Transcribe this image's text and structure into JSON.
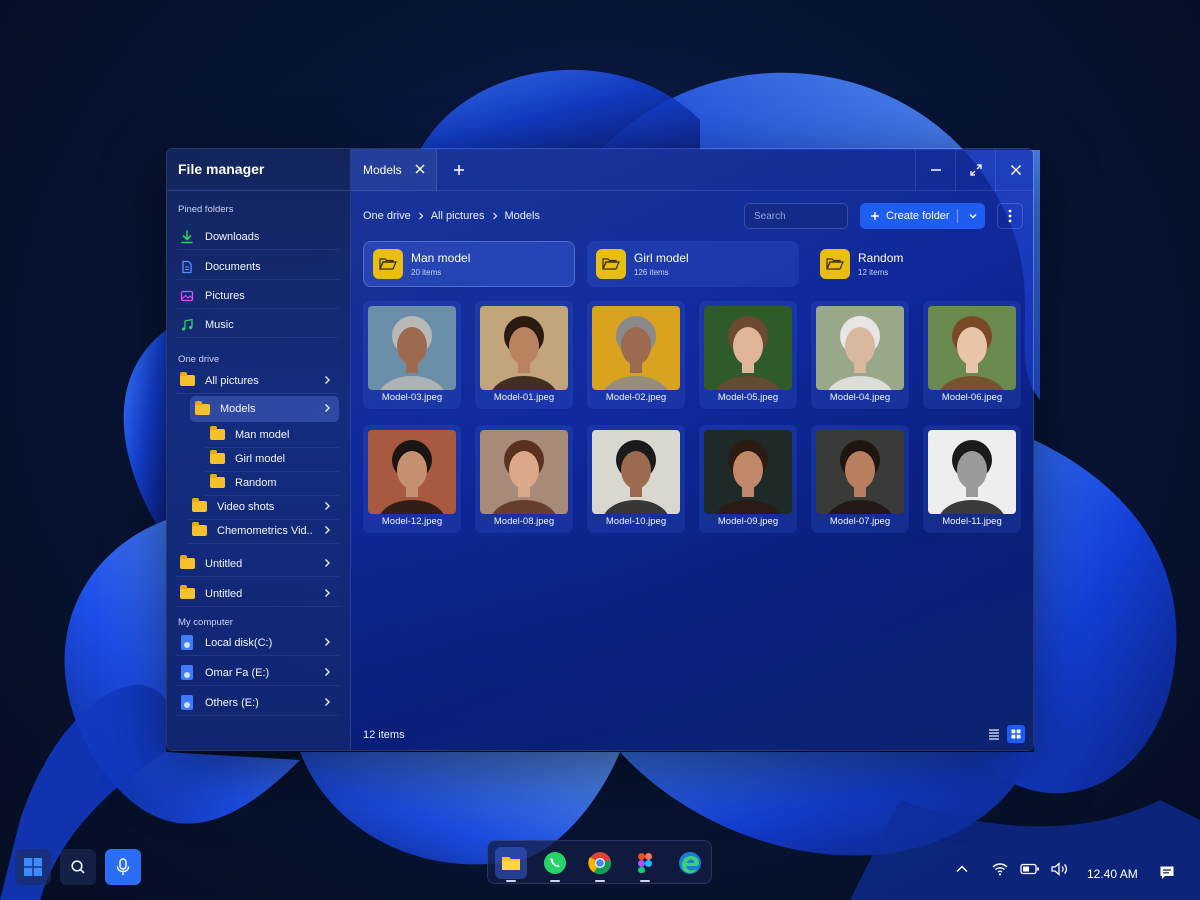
{
  "window": {
    "title": "File manager",
    "tab_label": "Models"
  },
  "sidebar": {
    "sections": {
      "pinned": "Pined folders",
      "onedrive": "One drive",
      "computer": "My computer"
    },
    "pinned": [
      {
        "label": "Downloads",
        "icon": "download-icon"
      },
      {
        "label": "Documents",
        "icon": "document-icon"
      },
      {
        "label": "Pictures",
        "icon": "image-icon"
      },
      {
        "label": "Music",
        "icon": "music-icon"
      }
    ],
    "onedrive": [
      {
        "label": "All pictures"
      },
      {
        "label": "Models"
      },
      {
        "label": "Man model"
      },
      {
        "label": "Girl model"
      },
      {
        "label": "Random"
      },
      {
        "label": "Video shots"
      },
      {
        "label": "Chemometrics Vid.."
      },
      {
        "label": "Untitled"
      },
      {
        "label": "Untitled"
      }
    ],
    "computer": [
      {
        "label": "Local disk(C:)"
      },
      {
        "label": "Omar Fa (E:)"
      },
      {
        "label": "Others (E:)"
      }
    ]
  },
  "toolbar": {
    "breadcrumb": [
      "One drive",
      "All pictures",
      "Models"
    ],
    "search_placeholder": "Search",
    "create_label": "Create folder"
  },
  "folders": [
    {
      "name": "Man model",
      "count": "20 items"
    },
    {
      "name": "Girl model",
      "count": "126 items"
    },
    {
      "name": "Random",
      "count": "12 items"
    }
  ],
  "files": [
    {
      "name": "Model-03.jpeg",
      "bg": "#6b8fa8",
      "skin": "#9c6a4f",
      "hair": "#b8b8b8"
    },
    {
      "name": "Model-01.jpeg",
      "bg": "#c2a57a",
      "skin": "#b88460",
      "hair": "#2b1a12"
    },
    {
      "name": "Model-02.jpeg",
      "bg": "#d9a320",
      "skin": "#9c6a4f",
      "hair": "#8a8a8a"
    },
    {
      "name": "Model-05.jpeg",
      "bg": "#2f5a2a",
      "skin": "#e0b59a",
      "hair": "#6b4a30"
    },
    {
      "name": "Model-04.jpeg",
      "bg": "#9aa88a",
      "skin": "#d9b8a0",
      "hair": "#e6e6e6"
    },
    {
      "name": "Model-06.jpeg",
      "bg": "#6b8a50",
      "skin": "#e8c4a8",
      "hair": "#7a4a28"
    },
    {
      "name": "Model-12.jpeg",
      "bg": "#a85a40",
      "skin": "#c49070",
      "hair": "#1c1410"
    },
    {
      "name": "Model-08.jpeg",
      "bg": "#a88a78",
      "skin": "#d8a888",
      "hair": "#5a3020"
    },
    {
      "name": "Model-10.jpeg",
      "bg": "#d8d8d0",
      "skin": "#9c6a4f",
      "hair": "#1a1a1a"
    },
    {
      "name": "Model-09.jpeg",
      "bg": "#1e2a28",
      "skin": "#c08868",
      "hair": "#2a1a10"
    },
    {
      "name": "Model-07.jpeg",
      "bg": "#3a3a38",
      "skin": "#b88060",
      "hair": "#1e1410"
    },
    {
      "name": "Model-11.jpeg",
      "bg": "#eeeeee",
      "skin": "#9a9a9a",
      "hair": "#1a1a1a"
    }
  ],
  "status": {
    "count": "12 items"
  },
  "taskbar": {
    "clock": "12.40 AM",
    "apps": [
      "file-explorer-icon",
      "whatsapp-icon",
      "chrome-icon",
      "figma-icon",
      "edge-icon"
    ]
  },
  "colors": {
    "accent": "#1f5cf0",
    "folder": "#e8be12"
  }
}
